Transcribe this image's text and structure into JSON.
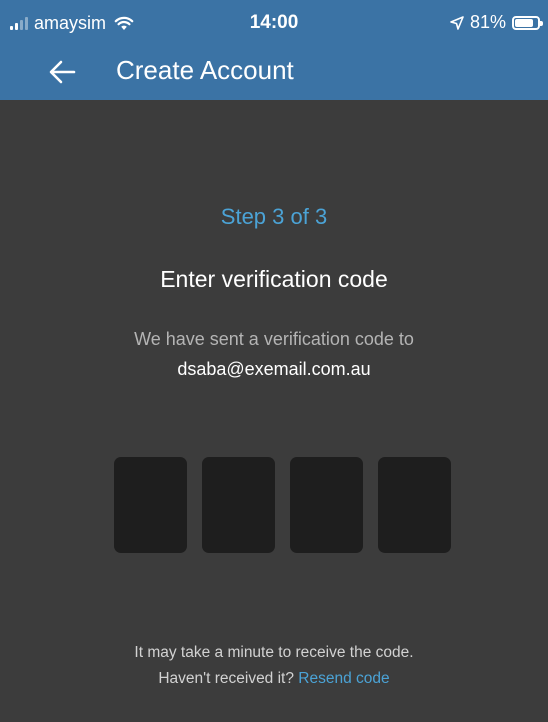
{
  "status_bar": {
    "carrier": "amaysim",
    "time": "14:00",
    "battery_percent": "81%",
    "battery_level": 0.81,
    "icons": [
      "signal-icon",
      "wifi-icon",
      "location-arrow-icon",
      "battery-icon"
    ]
  },
  "app_bar": {
    "title": "Create Account",
    "back_icon": "arrow-left-icon"
  },
  "verification": {
    "step": "Step 3 of 3",
    "heading": "Enter verification code",
    "sent_text": "We have sent a verification code to",
    "email": "dsaba@exemail.com.au",
    "code_digits": [
      "",
      "",
      "",
      ""
    ]
  },
  "footer": {
    "note": "It may take a minute to receive the code.",
    "not_received": "Haven't received it?",
    "resend_label": "Resend code"
  },
  "colors": {
    "header_bg": "#3b73a5",
    "page_bg": "#3c3c3c",
    "accent": "#4ba3d6",
    "code_box_bg": "#1e1e1e"
  }
}
